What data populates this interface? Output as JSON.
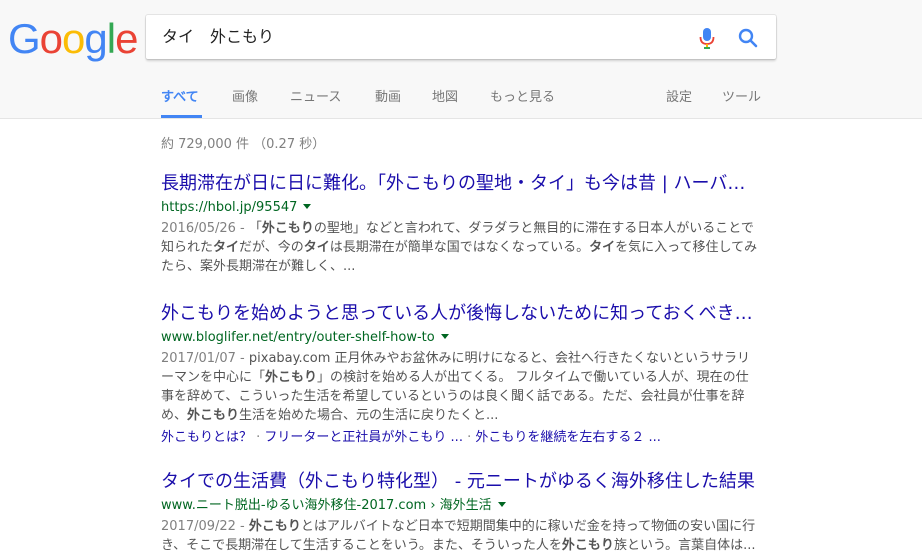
{
  "logo": {
    "letters": [
      "G",
      "o",
      "o",
      "g",
      "l",
      "e"
    ],
    "colors": [
      "#4285f4",
      "#ea4335",
      "#fbbc05",
      "#4285f4",
      "#34a853",
      "#ea4335"
    ]
  },
  "search": {
    "query": "タイ　外こもり"
  },
  "icons": {
    "mic": "microphone-icon",
    "search": "search-icon"
  },
  "tabs": {
    "all": "すべて",
    "images": "画像",
    "news": "ニュース",
    "videos": "動画",
    "maps": "地図",
    "more": "もっと見る",
    "settings": "設定",
    "tools": "ツール"
  },
  "stats": "約 729,000 件 （0.27 秒）",
  "results": [
    {
      "title": "長期滞在が日に日に難化。「外こもりの聖地・タイ」も今は昔 | ハーバ…",
      "url": "https://hbol.jp/95547",
      "snippet": [
        {
          "t": "2016/05/26 - ",
          "c": "date"
        },
        {
          "t": "「"
        },
        {
          "t": "外こもり",
          "b": true
        },
        {
          "t": "の聖地」などと言われて、ダラダラと無目的に滞在する日本人がいることで知られた"
        },
        {
          "t": "タイ",
          "b": true
        },
        {
          "t": "だが、今の"
        },
        {
          "t": "タイ",
          "b": true
        },
        {
          "t": "は長期滞在が簡単な国ではなくなっている。"
        },
        {
          "t": "タイ",
          "b": true
        },
        {
          "t": "を気に入って移住してみたら、案外長期滞在が難しく、..."
        }
      ]
    },
    {
      "title": "外こもりを始めようと思っている人が後悔しないために知っておくべき…",
      "url": "www.bloglifer.net/entry/outer-shelf-how-to",
      "snippet": [
        {
          "t": "2017/01/07 - ",
          "c": "date"
        },
        {
          "t": "pixabay.com 正月休みやお盆休みに明けになると、会社へ行きたくないというサラリーマンを中心に「"
        },
        {
          "t": "外こもり",
          "b": true
        },
        {
          "t": "」の検討を始める人が出てくる。 フルタイムで働いている人が、現在の仕事を辞めて、こういった生活を希望しているというのは良く聞く話である。ただ、会社員が仕事を辞め、"
        },
        {
          "t": "外こもり",
          "b": true
        },
        {
          "t": "生活を始めた場合、元の生活に戻りたくと..."
        }
      ],
      "sublinks": [
        "外こもりとは？",
        "フリーターと正社員が外こもり ...",
        "外こもりを継続を左右する２ ..."
      ]
    },
    {
      "title": "タイでの生活費（外こもり特化型） - 元ニートがゆるく海外移住した結果",
      "url": "www.ニート脱出-ゆるい海外移住-2017.com › 海外生活",
      "snippet": [
        {
          "t": "2017/09/22 - ",
          "c": "date"
        },
        {
          "t": "外こもり",
          "b": true
        },
        {
          "t": "とはアルバイトなど日本で短期間集中的に稼いだ金を持って物価の安い国に行き、そこで長期滞在して生活することをいう。また、そういった人を"
        },
        {
          "t": "外こもり",
          "b": true
        },
        {
          "t": "族という。言葉自体は..."
        }
      ]
    }
  ]
}
